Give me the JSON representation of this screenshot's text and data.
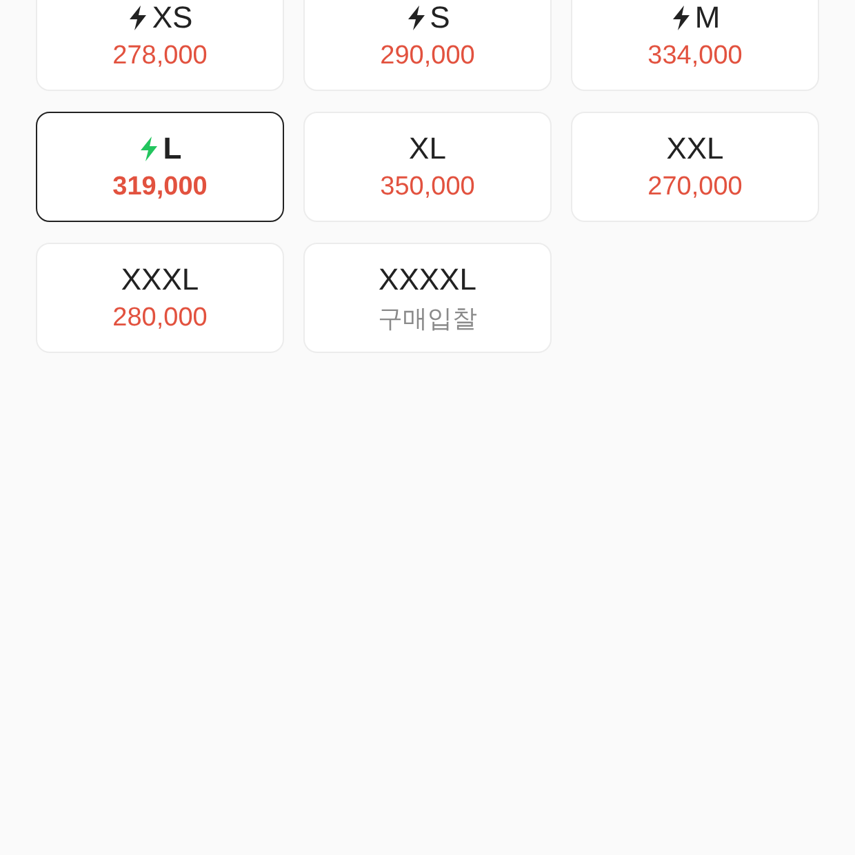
{
  "sizes": [
    {
      "size": "XS",
      "price": "278,000",
      "express": true,
      "kind": "price",
      "selected": false
    },
    {
      "size": "S",
      "price": "290,000",
      "express": true,
      "kind": "price",
      "selected": false
    },
    {
      "size": "M",
      "price": "334,000",
      "express": true,
      "kind": "price",
      "selected": false
    },
    {
      "size": "L",
      "price": "319,000",
      "express": true,
      "kind": "price",
      "selected": true
    },
    {
      "size": "XL",
      "price": "350,000",
      "express": false,
      "kind": "price",
      "selected": false
    },
    {
      "size": "XXL",
      "price": "270,000",
      "express": false,
      "kind": "price",
      "selected": false
    },
    {
      "size": "XXXL",
      "price": "280,000",
      "express": false,
      "kind": "price",
      "selected": false
    },
    {
      "size": "XXXXL",
      "price": "구매입찰",
      "express": false,
      "kind": "bid",
      "selected": false
    }
  ]
}
